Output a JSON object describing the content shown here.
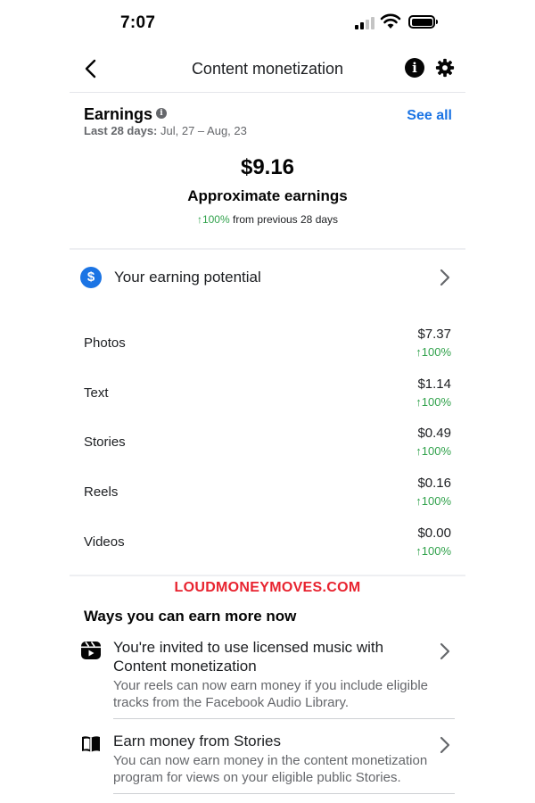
{
  "status_bar": {
    "time": "7:07"
  },
  "nav": {
    "title": "Content monetization"
  },
  "earnings": {
    "title": "Earnings",
    "see_all": "See all",
    "range_label": "Last 28 days:",
    "range_value": "Jul, 27 – Aug, 23",
    "total": "$9.16",
    "total_label": "Approximate earnings",
    "trend_pct": "↑100%",
    "trend_suffix": "from previous 28 days"
  },
  "potential": {
    "label": "Your earning potential",
    "icon": "$"
  },
  "breakdown": [
    {
      "name": "Photos",
      "value": "$7.37",
      "change": "↑100%"
    },
    {
      "name": "Text",
      "value": "$1.14",
      "change": "↑100%"
    },
    {
      "name": "Stories",
      "value": "$0.49",
      "change": "↑100%"
    },
    {
      "name": "Reels",
      "value": "$0.16",
      "change": "↑100%"
    },
    {
      "name": "Videos",
      "value": "$0.00",
      "change": "↑100%"
    }
  ],
  "watermark": "LOUDMONEYMOVES.COM",
  "ways": {
    "title": "Ways you can earn more now",
    "items": [
      {
        "title": "You're invited to use licensed music with Content monetization",
        "description": "Your reels can now earn money if you include eligible tracks from the Facebook Audio Library."
      },
      {
        "title": "Earn money from Stories",
        "description": "You can now earn money in the content monetization program for views on your eligible public Stories."
      }
    ]
  },
  "colors": {
    "accent": "#1b74e4",
    "positive": "#31a24c",
    "watermark": "#e8232f"
  }
}
